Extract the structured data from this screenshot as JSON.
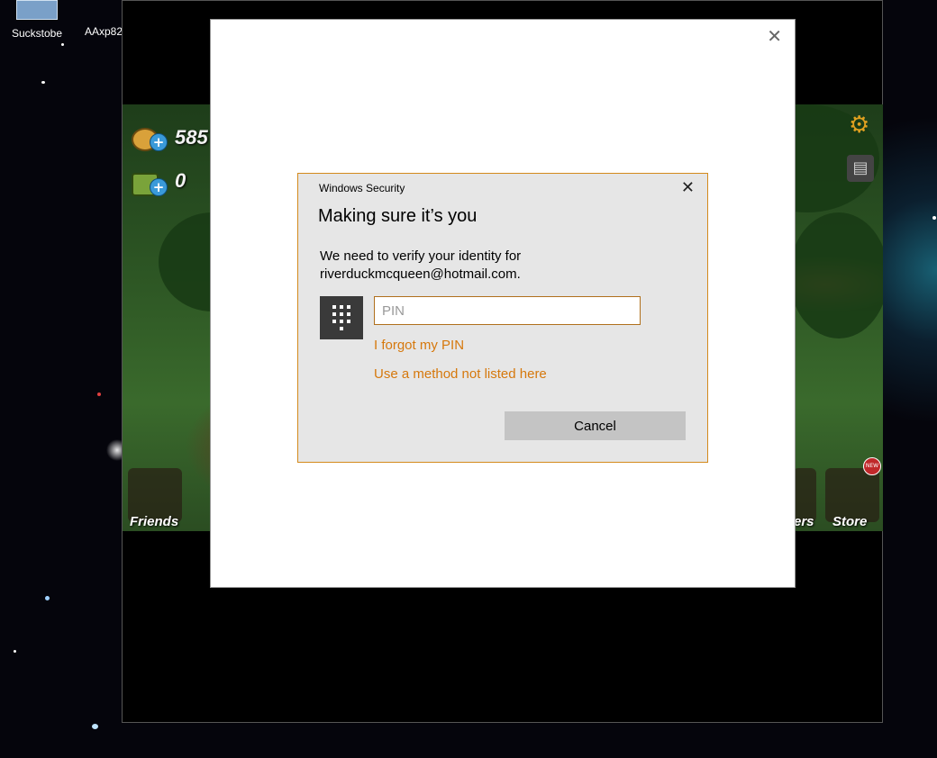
{
  "desktop": {
    "icons": [
      {
        "label": "Suckstobe",
        "icon": "app-thumbnail-icon"
      },
      {
        "label": "AAxp82",
        "icon": "app-icon"
      }
    ]
  },
  "game": {
    "coins": "585",
    "cash": "0",
    "bottom_tiles": [
      {
        "label": "Friends"
      },
      {
        "label": "ers"
      },
      {
        "label": "Store"
      }
    ],
    "new_badge": "NEW",
    "icons": {
      "settings": "gear-icon",
      "orders": "document-icon"
    }
  },
  "outer_dialog": {
    "close_glyph": "✕"
  },
  "windows_security": {
    "caption": "Windows Security",
    "title": "Making sure it’s you",
    "description_line1": "We need to verify your identity for",
    "description_line2": "riverduckmcqueen@hotmail.com.",
    "pin_placeholder": "PIN",
    "pin_value": "",
    "forgot_pin": "I forgot my PIN",
    "other_method": "Use a method not listed here",
    "cancel": "Cancel",
    "close_glyph": "✕",
    "accent": "#d48a1c",
    "link_color": "#d6780c"
  }
}
